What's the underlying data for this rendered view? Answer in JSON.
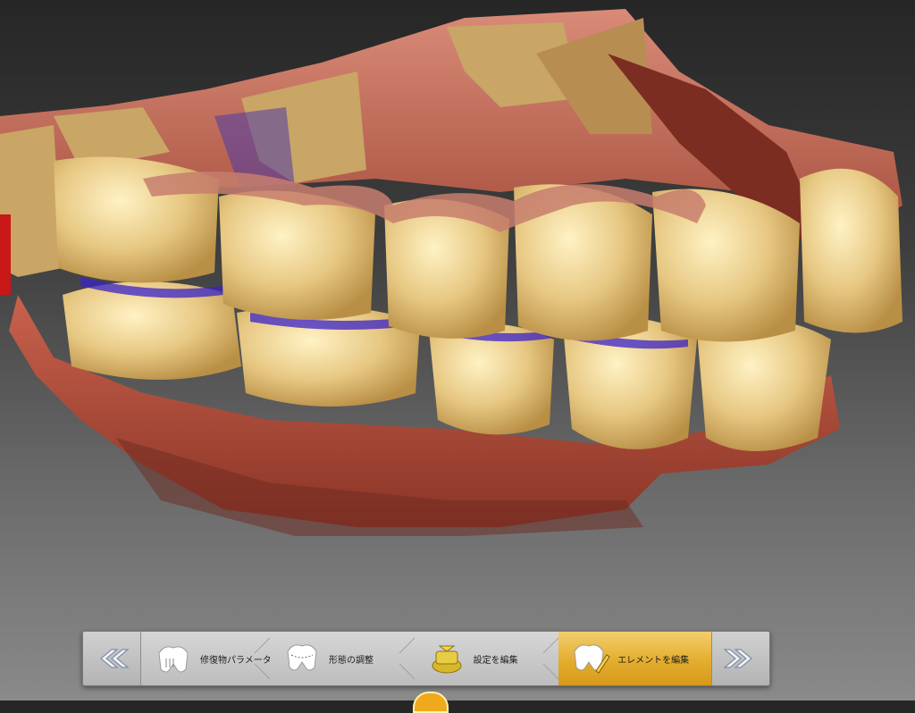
{
  "viewport": {
    "name": "3D dental scan view",
    "icon": "dental-arch-scan-icon"
  },
  "workflow": {
    "prev_icon": "double-chevron-left-icon",
    "next_icon": "double-chevron-right-icon",
    "steps": [
      {
        "label": "修復物パラメーター",
        "icon": "crown-parameters-icon",
        "active": false
      },
      {
        "label": "形態の調整",
        "icon": "crown-shape-adjust-icon",
        "active": false
      },
      {
        "label": "設定を編集",
        "icon": "gold-settings-icon",
        "active": false
      },
      {
        "label": "エレメントを編集",
        "icon": "crown-edit-pencil-icon",
        "active": true
      }
    ],
    "active_color": "#e3ad2f"
  },
  "indicator_color": "#f0a81c"
}
